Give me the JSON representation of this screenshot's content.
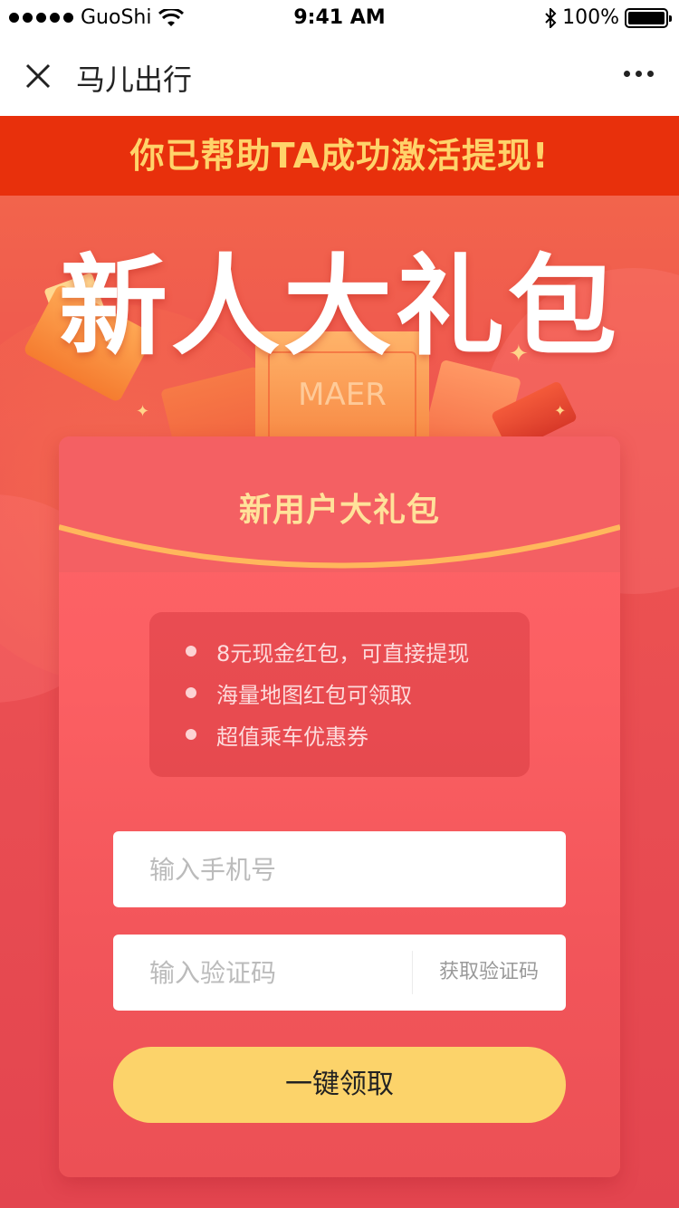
{
  "status_bar": {
    "carrier": "GuoShi",
    "time": "9:41 AM",
    "battery": "100%",
    "battery_level": 1.0
  },
  "nav": {
    "title": "马儿出行",
    "close_icon": "close-icon",
    "more_icon": "more-icon"
  },
  "banner": {
    "text": "你已帮助TA成功激活提现!"
  },
  "hero": {
    "title": "新人大礼包",
    "ticket_text": "MAER"
  },
  "card": {
    "title": "新用户大礼包",
    "benefits": [
      "8元现金红包，可直接提现",
      "海量地图红包可领取",
      "超值乘车优惠券"
    ],
    "phone_placeholder": "输入手机号",
    "code_placeholder": "输入验证码",
    "get_code_label": "获取验证码",
    "claim_label": "一键领取"
  },
  "colors": {
    "banner_bg": "#e8300c",
    "banner_text": "#ffd36a",
    "card_title": "#ffe29a",
    "claim_button": "#fcd36a"
  }
}
